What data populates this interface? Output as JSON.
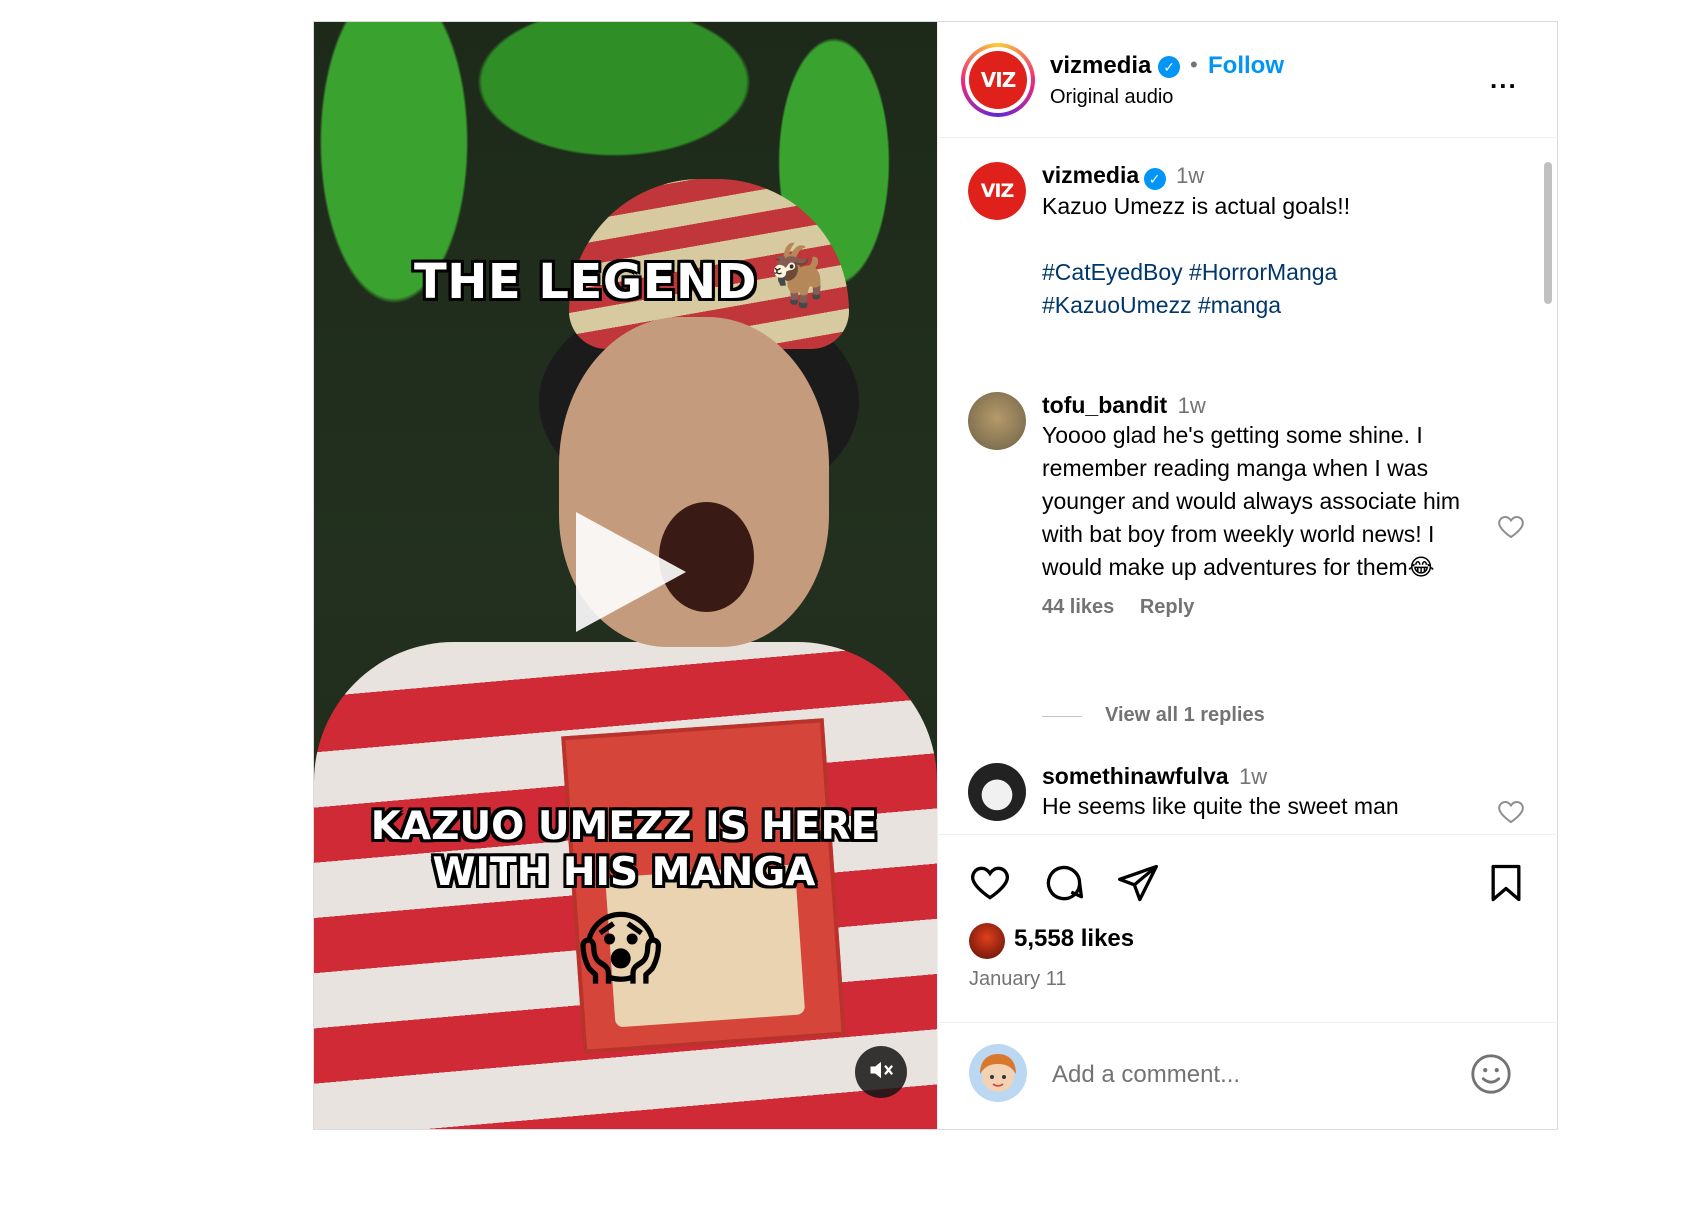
{
  "media": {
    "overlay_top": "THE LEGEND",
    "overlay_top_emoji": "🐐",
    "overlay_bottom": "KAZUO UMEZZ IS HERE WITH HIS MANGA",
    "overlay_bottom_emoji": "😱"
  },
  "header": {
    "username": "vizmedia",
    "verified": "✓",
    "separator": "•",
    "follow_label": "Follow",
    "audio_label": "Original audio",
    "more": "...",
    "logo_text": "VIZ"
  },
  "caption": {
    "username": "vizmedia",
    "time": "1w",
    "text": "Kazuo Umezz is actual goals!!",
    "tags_line1": "#CatEyedBoy #HorrorManga",
    "tags_line2": "#KazuoUmezz #manga"
  },
  "comments": [
    {
      "username": "tofu_bandit",
      "time": "1w",
      "text": "Yoooo glad he's getting some shine. I remember reading manga when I was younger and would always associate him with bat boy from weekly world news! I would make up adventures for them😂",
      "likes": "44 likes",
      "reply": "Reply",
      "view_replies": "View all 1 replies"
    },
    {
      "username": "somethinawfulva",
      "time": "1w",
      "text": "He seems like quite the sweet man"
    }
  ],
  "actions": {
    "likes": "5,558 likes",
    "date": "January 11"
  },
  "add_comment": {
    "placeholder": "Add a comment..."
  },
  "icons": {
    "like": "heart-icon",
    "comment": "comment-icon",
    "share": "paper-plane-icon",
    "save": "bookmark-icon",
    "mute": "speaker-muted-icon",
    "play": "play-icon",
    "emoji": "emoji-icon"
  },
  "colors": {
    "accent": "#0095f6",
    "hashtag": "#00376b",
    "muted_text": "#737373",
    "viz_red": "#e0201a"
  }
}
